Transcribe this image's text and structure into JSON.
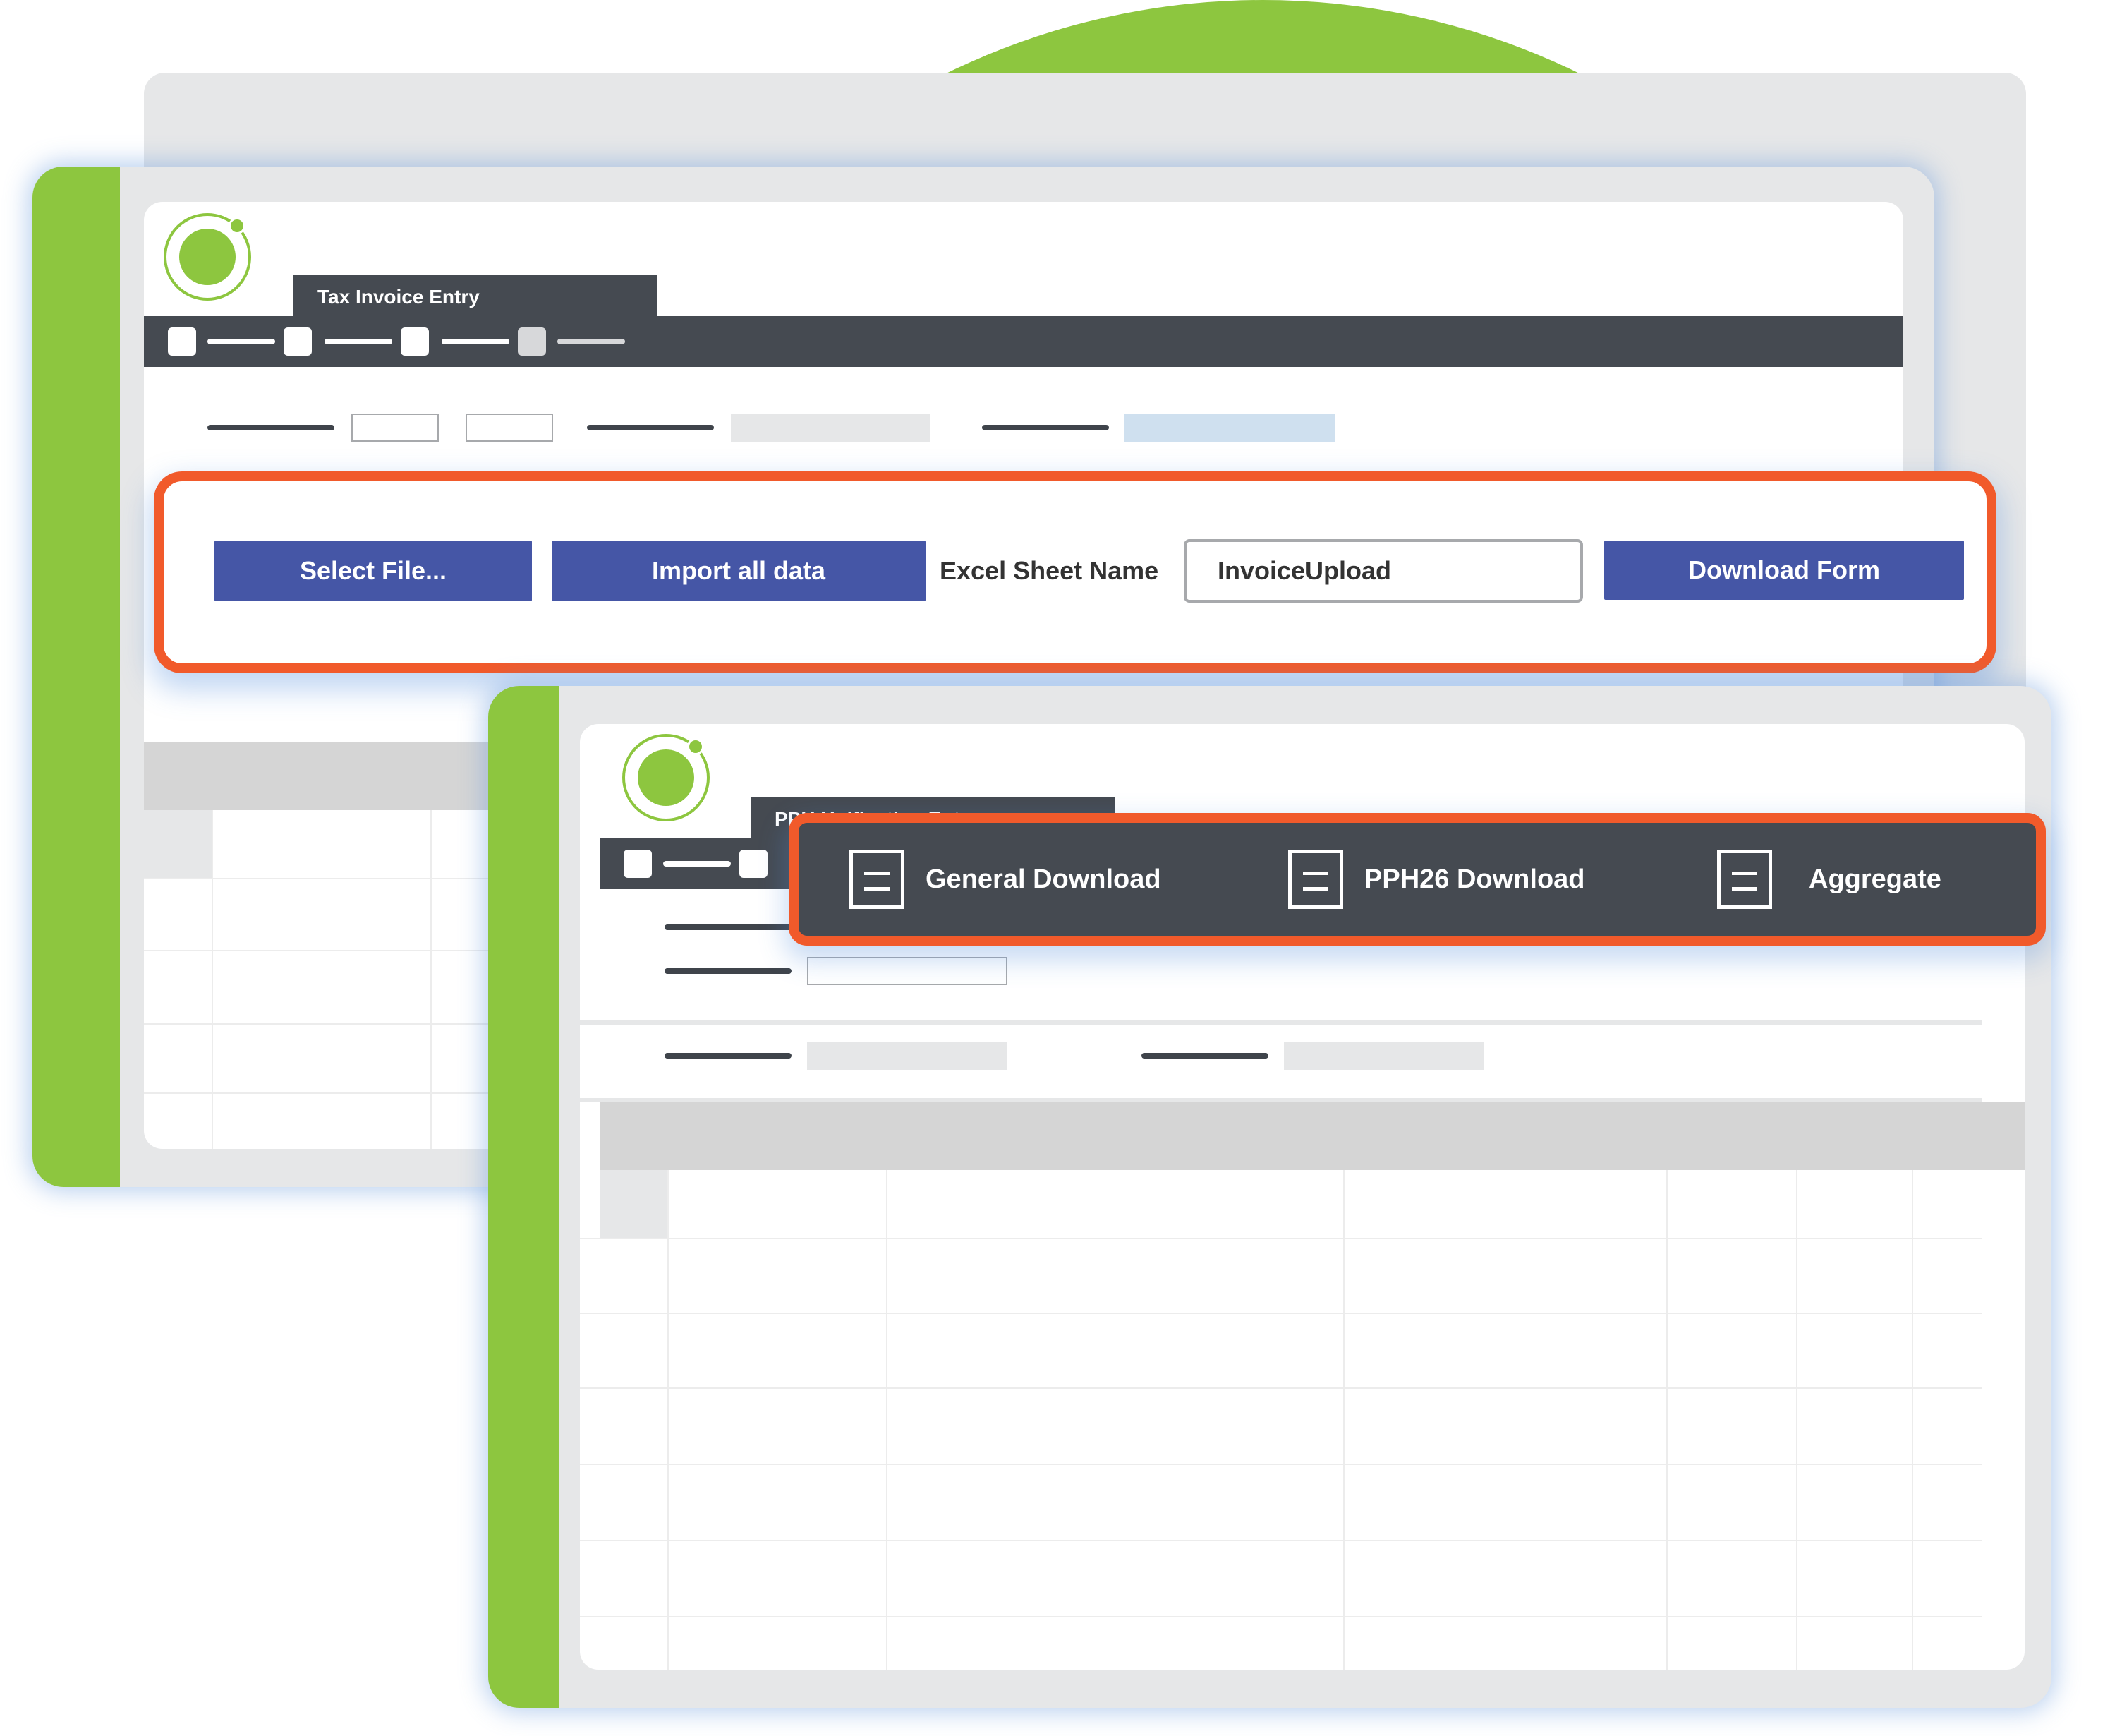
{
  "window1": {
    "tab_title": "Tax Invoice Entry"
  },
  "import_panel": {
    "select_file_label": "Select File...",
    "import_label": "Import all data",
    "sheet_name_label": "Excel Sheet Name",
    "sheet_name_value": "InvoiceUpload",
    "download_form_label": "Download Form"
  },
  "window2": {
    "tab_title": "PPH Unification Entry"
  },
  "download_menu": {
    "items": [
      {
        "label": "General Download",
        "icon": "document-icon"
      },
      {
        "label": "PPH26 Download",
        "icon": "document-icon"
      },
      {
        "label": "Aggregate",
        "icon": "document-icon"
      }
    ]
  },
  "colors": {
    "accent_green": "#8dc63f",
    "highlight_orange": "#f15a2b",
    "button_blue": "#4556a6",
    "toolbar_dark": "#454a51"
  }
}
